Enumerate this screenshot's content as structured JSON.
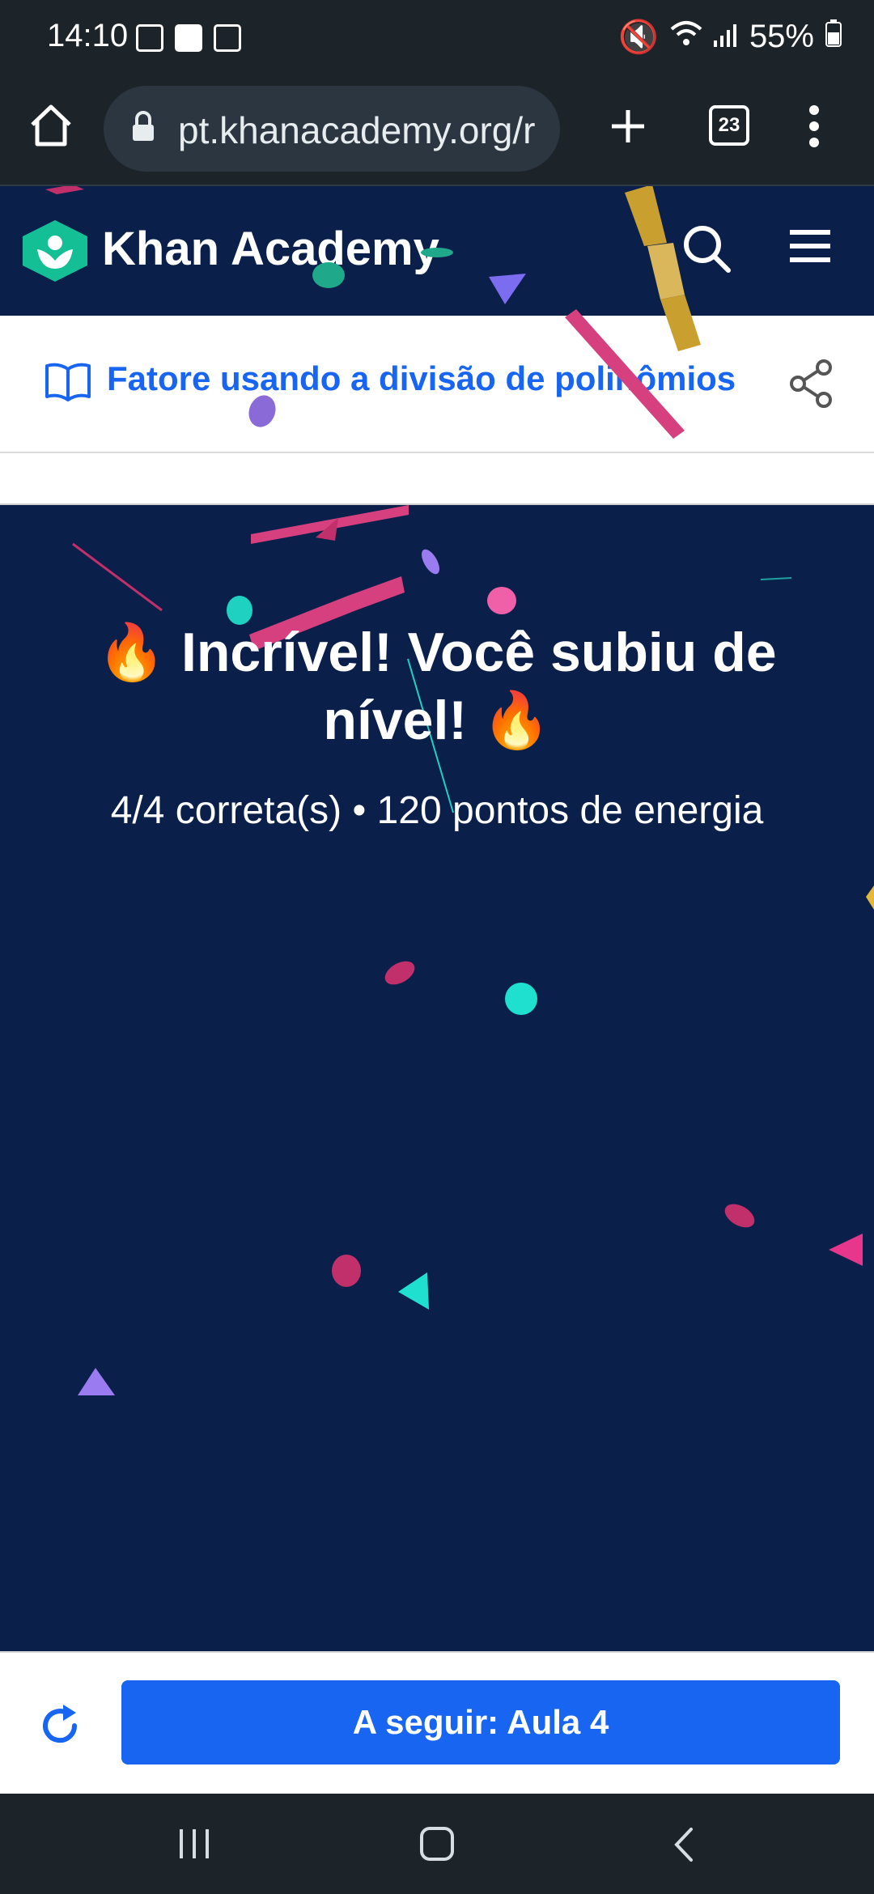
{
  "status_bar": {
    "time": "14:10",
    "battery": "55%"
  },
  "browser": {
    "url": "pt.khanacademy.org/r",
    "tab_count": "23"
  },
  "header": {
    "brand": "Khan Academy"
  },
  "breadcrumb": {
    "title": "Fatore usando a divisão de polinômios"
  },
  "result": {
    "title": "Incrível! Você subiu de nível!",
    "fire_emoji": "🔥",
    "stats": "4/4 correta(s) • 120 pontos de energia"
  },
  "footer": {
    "next_button": "A seguir: Aula 4"
  },
  "colors": {
    "navy": "#0b1f4b",
    "blue": "#1865f2",
    "teal": "#14bf96"
  }
}
